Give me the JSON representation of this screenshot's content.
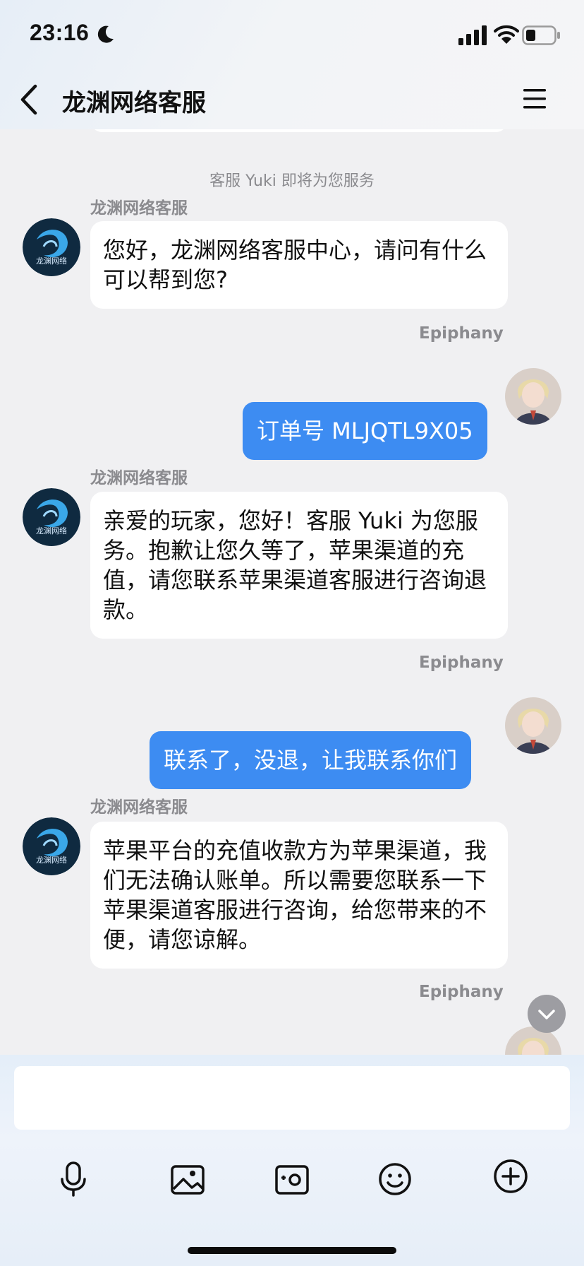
{
  "status_bar": {
    "time": "23:16"
  },
  "header": {
    "title": "龙渊网络客服"
  },
  "chat": {
    "system_note": "客服 Yuki 即将为您服务",
    "messages": [
      {
        "from": "agent",
        "sender": "龙渊网络客服",
        "text": "您好，龙渊网络客服中心，请问有什么可以帮到您?"
      },
      {
        "from": "user",
        "sender": "Epiphany",
        "text": "订单号 MLJQTL9X05"
      },
      {
        "from": "agent",
        "sender": "龙渊网络客服",
        "text": "亲爱的玩家，您好！客服 Yuki 为您服务。抱歉让您久等了，苹果渠道的充值，请您联系苹果渠道客服进行咨询退款。"
      },
      {
        "from": "user",
        "sender": "Epiphany",
        "text": "联系了，没退，让我联系你们"
      },
      {
        "from": "agent",
        "sender": "龙渊网络客服",
        "text": "苹果平台的充值收款方为苹果渠道，我们无法确认账单。所以需要您联系一下苹果渠道客服进行咨询，给您带来的不便，请您谅解。"
      },
      {
        "from": "user",
        "sender": "Epiphany",
        "text": ""
      }
    ]
  },
  "agent_avatar": {
    "caption": "龙渊网络"
  },
  "toolbar": {
    "input_value": "",
    "icons": [
      "microphone-icon",
      "image-icon",
      "camera-icon",
      "emoji-icon",
      "plus-circle-icon"
    ]
  },
  "colors": {
    "user_bubble": "#3d8cf2",
    "agent_bubble": "#ffffff",
    "background": "#f0f0f2"
  }
}
